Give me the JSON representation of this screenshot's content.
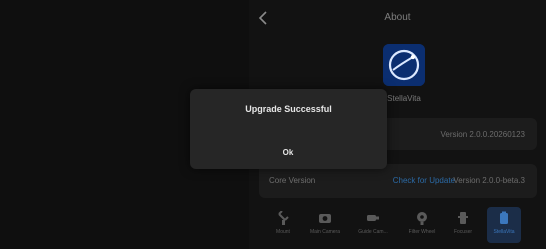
{
  "header": {
    "title": "About"
  },
  "app": {
    "name": "StellaVita"
  },
  "version_row": {
    "label": "",
    "value": "Version 2.0.0.20260123"
  },
  "core_row": {
    "label": "Core Version",
    "link": "Check for Update",
    "value": "Version 2.0.0-beta.3"
  },
  "nav": {
    "items": [
      {
        "label": "Mount",
        "icon": "telescope-icon"
      },
      {
        "label": "Main Camera",
        "icon": "camera-icon"
      },
      {
        "label": "Guide Cam...",
        "icon": "guide-camera-icon"
      },
      {
        "label": "Filter Wheel",
        "icon": "filter-wheel-icon"
      },
      {
        "label": "Focuser",
        "icon": "focuser-icon"
      },
      {
        "label": "StellaVita",
        "icon": "stellavita-icon"
      }
    ],
    "active_index": 5
  },
  "modal": {
    "title": "Upgrade Successful",
    "ok_label": "Ok"
  },
  "colors": {
    "accent": "#3b77bd",
    "link": "#2b6aa6",
    "modal_bg": "#262626"
  }
}
